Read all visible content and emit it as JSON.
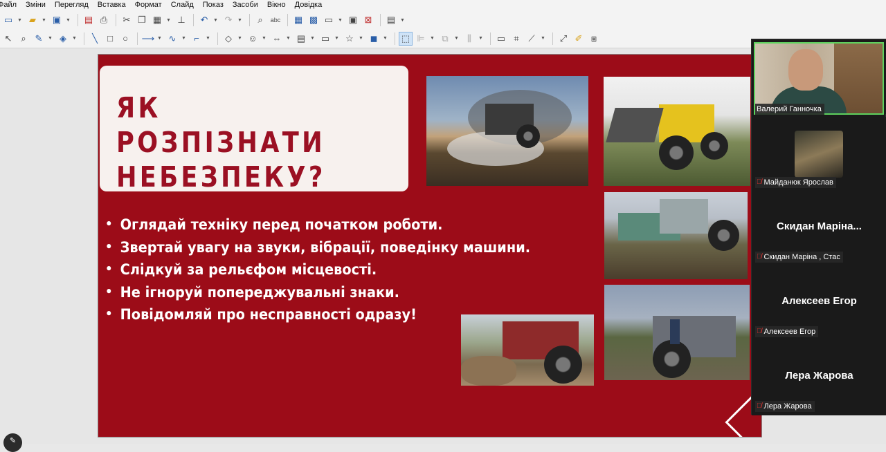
{
  "menu": [
    "Файл",
    "Зміни",
    "Перегляд",
    "Вставка",
    "Формат",
    "Слайд",
    "Показ",
    "Засоби",
    "Вікно",
    "Довідка"
  ],
  "toolbar1_icons": [
    "new-icon",
    "open-icon",
    "save-icon",
    "export-pdf-icon",
    "print-icon",
    "cut-icon",
    "copy-icon",
    "paste-icon",
    "clone-formatting-icon",
    "undo-icon",
    "redo-icon",
    "find-icon",
    "spelling-icon",
    "grid-icon",
    "snap-icon",
    "display-views-icon",
    "master-slide-icon",
    "delete-slide-icon",
    "slide-layout-icon"
  ],
  "toolbar2_icons": [
    "select-icon",
    "zoom-icon",
    "line-color-icon",
    "fill-color-icon",
    "line-icon",
    "rectangle-icon",
    "ellipse-icon",
    "arrow-icon",
    "curve-icon",
    "connector-icon",
    "basic-shapes-icon",
    "symbol-shapes-icon",
    "block-arrows-icon",
    "flowchart-icon",
    "callouts-icon",
    "stars-icon",
    "3d-objects-icon",
    "points-icon",
    "align-icon",
    "arrange-icon",
    "distribute-icon",
    "shadow-icon",
    "crop-icon",
    "filter-icon",
    "transform-icon",
    "glue-icon",
    "toggle-extrusion-icon"
  ],
  "slide": {
    "title": "ЯК РОЗПІЗНАТИ\nНЕБЕЗПЕКУ?",
    "bullets": [
      "Оглядай техніку перед початком роботи.",
      "Звертай увагу на звуки, вібрації, поведінку машини.",
      "Слідкуй за рельєфом місцевості.",
      "Не ігноруй попереджувальні знаки.",
      "Повідомляй про несправності одразу!"
    ],
    "colors": {
      "background": "#9c0c18",
      "title": "#9b1023",
      "title_box": "#f7f1ee",
      "bullet_text": "#ffffff"
    }
  },
  "participants": [
    {
      "name": "Валерий Ганночка",
      "video": true,
      "muted": false
    },
    {
      "name": "Майданюк Ярослав",
      "display": "",
      "muted": true,
      "avatar": true
    },
    {
      "name": "Скидан Маріна , Стас",
      "display": "Скидан  Маріна...",
      "muted": true
    },
    {
      "name": "Алексеев Егор",
      "display": "Алексеев Егор",
      "muted": true
    },
    {
      "name": "Лера Жарова",
      "display": "Лера Жарова",
      "muted": true
    }
  ]
}
